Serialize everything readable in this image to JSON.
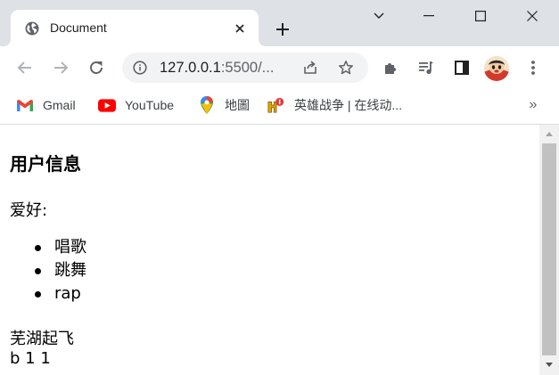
{
  "tab": {
    "title": "Document"
  },
  "address": {
    "host": "127.0.0.1",
    "rest": ":5500/..."
  },
  "bookmarks": [
    {
      "label": "Gmail",
      "icon": "gmail-icon"
    },
    {
      "label": "YouTube",
      "icon": "youtube-icon"
    },
    {
      "label": "地圖",
      "icon": "maps-icon"
    },
    {
      "label": "英雄战争 | 在线动...",
      "icon": "game-icon"
    }
  ],
  "bookmark_more": "»",
  "page": {
    "heading": "用户信息",
    "hobby_label": "爱好:",
    "hobbies": [
      "唱歌",
      "跳舞",
      "rap"
    ],
    "motto": "芜湖起飞",
    "bline": "b 1 1"
  },
  "colors": {
    "titlebar": "#dee1e6",
    "omnibox": "#f1f3f4",
    "scroll_thumb": "#c1c1c1",
    "youtube_red": "#ff0000"
  }
}
